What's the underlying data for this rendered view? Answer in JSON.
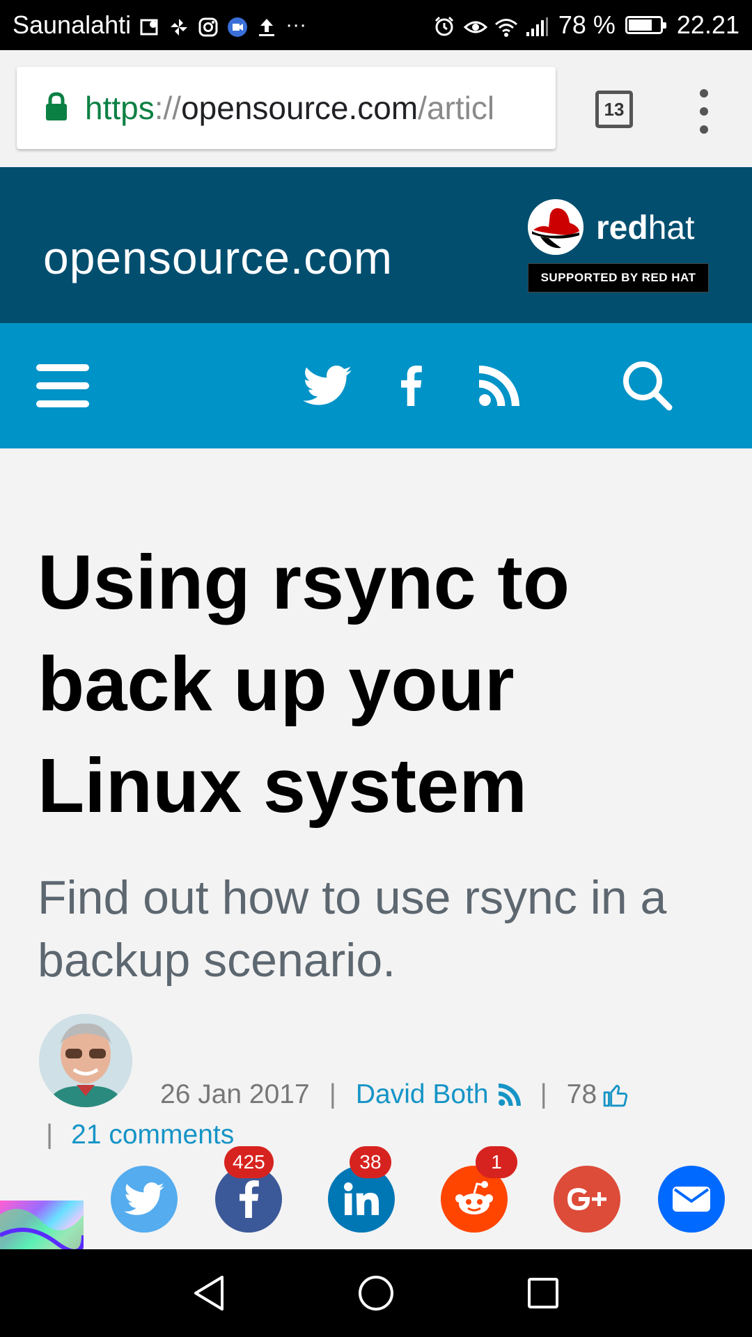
{
  "status_bar": {
    "carrier": "Saunalahti",
    "battery": "78 %",
    "battery_level": 0.78,
    "time": "22.21"
  },
  "browser": {
    "url_scheme": "https",
    "url_sep": "://",
    "url_host": "opensource.com",
    "url_path": "/articl",
    "tab_count": "13"
  },
  "site": {
    "logo": "opensource.com",
    "sponsor_word_bold": "red",
    "sponsor_word_light": "hat",
    "sponsor_tag": "SUPPORTED BY RED HAT"
  },
  "article": {
    "title": "Using rsync to back up your Linux system",
    "subtitle": "Find out how to use rsync in a backup scenario.",
    "date": "26 Jan 2017",
    "author": "David Both",
    "likes": "78",
    "comments": "21 comments"
  },
  "share": {
    "facebook_count": "425",
    "linkedin_count": "38",
    "reddit_count": "1"
  },
  "colors": {
    "header_dark": "#024e6f",
    "nav_blue": "#0093c7",
    "link_blue": "#1694c6",
    "twitter": "#55acee",
    "facebook": "#3b5998",
    "linkedin": "#0077b5",
    "reddit": "#ff4500",
    "googleplus": "#dd4b39",
    "email": "#0069ff"
  }
}
